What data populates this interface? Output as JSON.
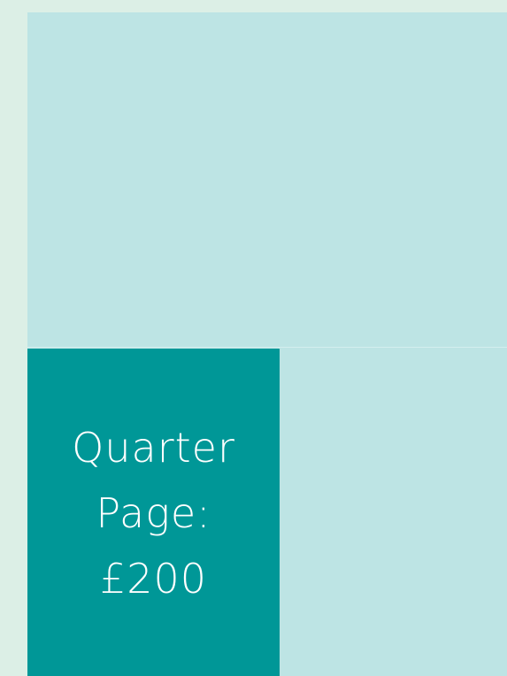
{
  "ad_block": {
    "line1": "Quarter",
    "line2": "Page:",
    "line3": "£200"
  }
}
